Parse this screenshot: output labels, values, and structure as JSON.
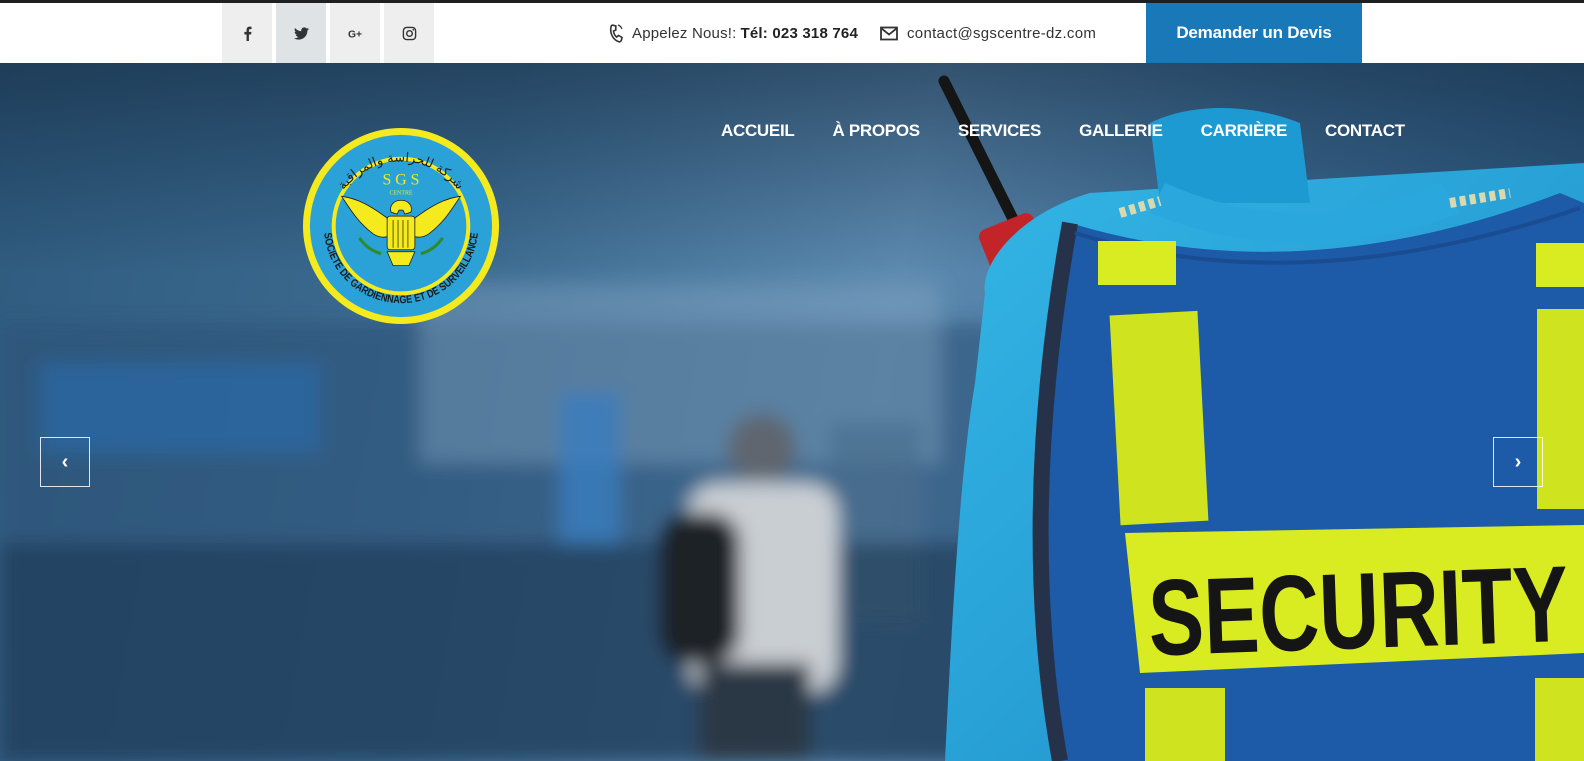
{
  "social": {
    "items": [
      {
        "icon": "facebook-icon",
        "glyph": "f"
      },
      {
        "icon": "twitter-icon",
        "glyph": "t"
      },
      {
        "icon": "google-plus-icon",
        "glyph": "G+"
      },
      {
        "icon": "instagram-icon",
        "glyph": "ig"
      }
    ]
  },
  "contact": {
    "phone_label": "Appelez Nous!:",
    "phone_number": "Tél: 023 318 764",
    "email": "contact@sgscentre-dz.com",
    "phone_icon": "phone-icon",
    "email_icon": "envelope-icon"
  },
  "quote_button": "Demander un Devis",
  "nav": [
    "ACCUEIL",
    "À PROPOS",
    "SERVICES",
    "GALLERIE",
    "CARRIÈRE",
    "CONTACT"
  ],
  "logo": {
    "top_letters": "S G S",
    "centre": "CENTRE",
    "ring_text": "SOCIETE DE GARDIENNAGE ET DE SURVEILLANCE",
    "arabic_text": "شركة للحراسة والمراقبة"
  },
  "hero": {
    "vest_text": "SECURITY",
    "prev_glyph": "‹",
    "next_glyph": "›"
  },
  "colors": {
    "accent": "#1878b8",
    "logo_yellow": "#f5ea1e",
    "logo_blue": "#2aa2d8",
    "vest_yellow": "#d9ec22",
    "vest_blue": "#1d5aa8",
    "shirt_blue": "#2aa8dd"
  }
}
